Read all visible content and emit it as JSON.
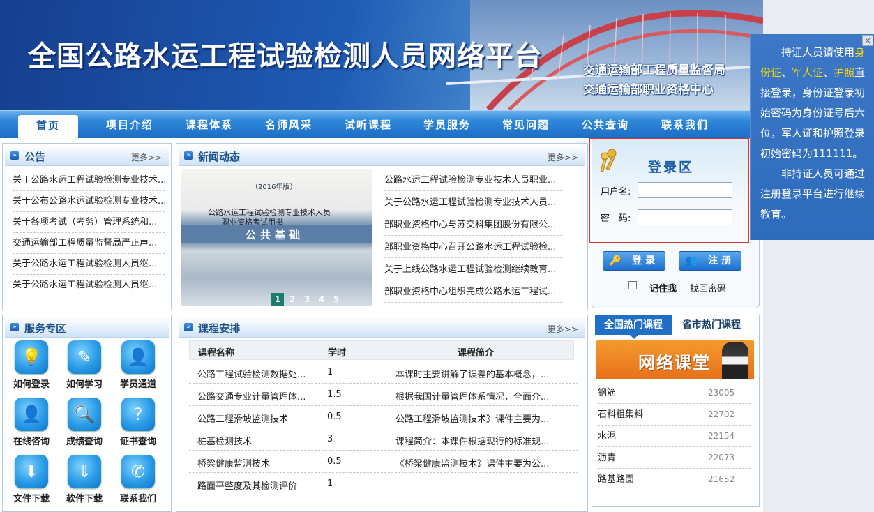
{
  "banner": {
    "title": "全国公路水运工程试验检测人员网络平台",
    "org_line1": "交通运输部工程质量监督局",
    "org_line2": "交通运输部职业资格中心"
  },
  "nav": [
    "首页",
    "项目介绍",
    "课程体系",
    "名师风采",
    "试听课程",
    "学员服务",
    "常见问题",
    "公共查询",
    "联系我们"
  ],
  "notice_panel": {
    "title": "公告",
    "more": "更多>>",
    "items": [
      "关于公路水运工程试验检测专业技术...",
      "关于公布公路水运试验检测专业技术...",
      "关于各项考试（考务）管理系统和...",
      "交通运输部工程质量监督局严正声...",
      "关于公路水运工程试验检测人员继...",
      "关于公路水运工程试验检测人员继..."
    ]
  },
  "news": {
    "title": "新闻动态",
    "more": "更多>>",
    "cover": {
      "year": "（2016年版）",
      "t1": "公路水运工程试验检测专业技术人员",
      "t2": "职业资格考试用书",
      "band": "公共基础"
    },
    "pager": [
      "1",
      "2",
      "3",
      "4",
      "5"
    ],
    "items": [
      "公路水运工程试验检测专业技术人员职业...",
      "关于公路水运工程试验检测专业技术人员...",
      "部职业资格中心与苏交科集团股份有限公...",
      "部职业资格中心召开公路水运工程试验检...",
      "关于上线公路水运工程试验检测继续教育...",
      "部职业资格中心组织完成公路水运工程试..."
    ]
  },
  "login": {
    "title": "登录区",
    "username_label": "用户名:",
    "password_label": "密　码:",
    "login_btn": "登录",
    "register_btn": "注册",
    "remember": "记住我",
    "recover": "找回密码"
  },
  "popup": {
    "close": "×",
    "p1_a": "持证人员请使用",
    "id_card": "身份证",
    "sep1": "、",
    "military": "军人证",
    "sep2": "、",
    "passport": "护照",
    "p1_b": "直接登录，身份证登录初始密码为身份证号后六位，军人证和护照登录初始密码为111111。",
    "p2": "非持证人员可通过注册登录平台进行继续教育。"
  },
  "service": {
    "title": "服务专区",
    "items": [
      {
        "label": "如何登录",
        "icon": "lightbulb-icon"
      },
      {
        "label": "如何学习",
        "icon": "pencil-icon"
      },
      {
        "label": "学员通道",
        "icon": "user-icon"
      },
      {
        "label": "在线咨询",
        "icon": "consult-icon"
      },
      {
        "label": "成绩查询",
        "icon": "magnifier-icon"
      },
      {
        "label": "证书查询",
        "icon": "question-icon"
      },
      {
        "label": "文件下载",
        "icon": "download-icon"
      },
      {
        "label": "软件下载",
        "icon": "software-download-icon"
      },
      {
        "label": "联系我们",
        "icon": "phone-icon"
      }
    ]
  },
  "courses": {
    "title": "课程安排",
    "more": "更多>>",
    "headers": [
      "课程名称",
      "学时",
      "课程简介"
    ],
    "rows": [
      [
        "公路工程试验检测数据处...",
        "1",
        "本课时主要讲解了误差的基本概念，..."
      ],
      [
        "公路交通专业计量管理体...",
        "1.5",
        "根据我国计量管理体系情况，全面介..."
      ],
      [
        "公路工程滑坡监测技术",
        "0.5",
        "公路工程滑坡监测技术》课件主要为..."
      ],
      [
        "桩基检测技术",
        "3",
        "课程简介：本课件根据现行的标准规..."
      ],
      [
        "桥梁健康监测技术",
        "0.5",
        "《桥梁健康监测技术》课件主要为公..."
      ],
      [
        "路面平整度及其检测评价",
        "1",
        ""
      ]
    ]
  },
  "hot": {
    "tab_national": "全国热门课程",
    "tab_provincial": "省市热门课程",
    "banner_text": "网络课堂",
    "items": [
      {
        "name": "钢筋",
        "count": "23005"
      },
      {
        "name": "石料粗集料",
        "count": "22702"
      },
      {
        "name": "水泥",
        "count": "22154"
      },
      {
        "name": "沥青",
        "count": "22073"
      },
      {
        "name": "路基路面",
        "count": "21652"
      }
    ]
  }
}
